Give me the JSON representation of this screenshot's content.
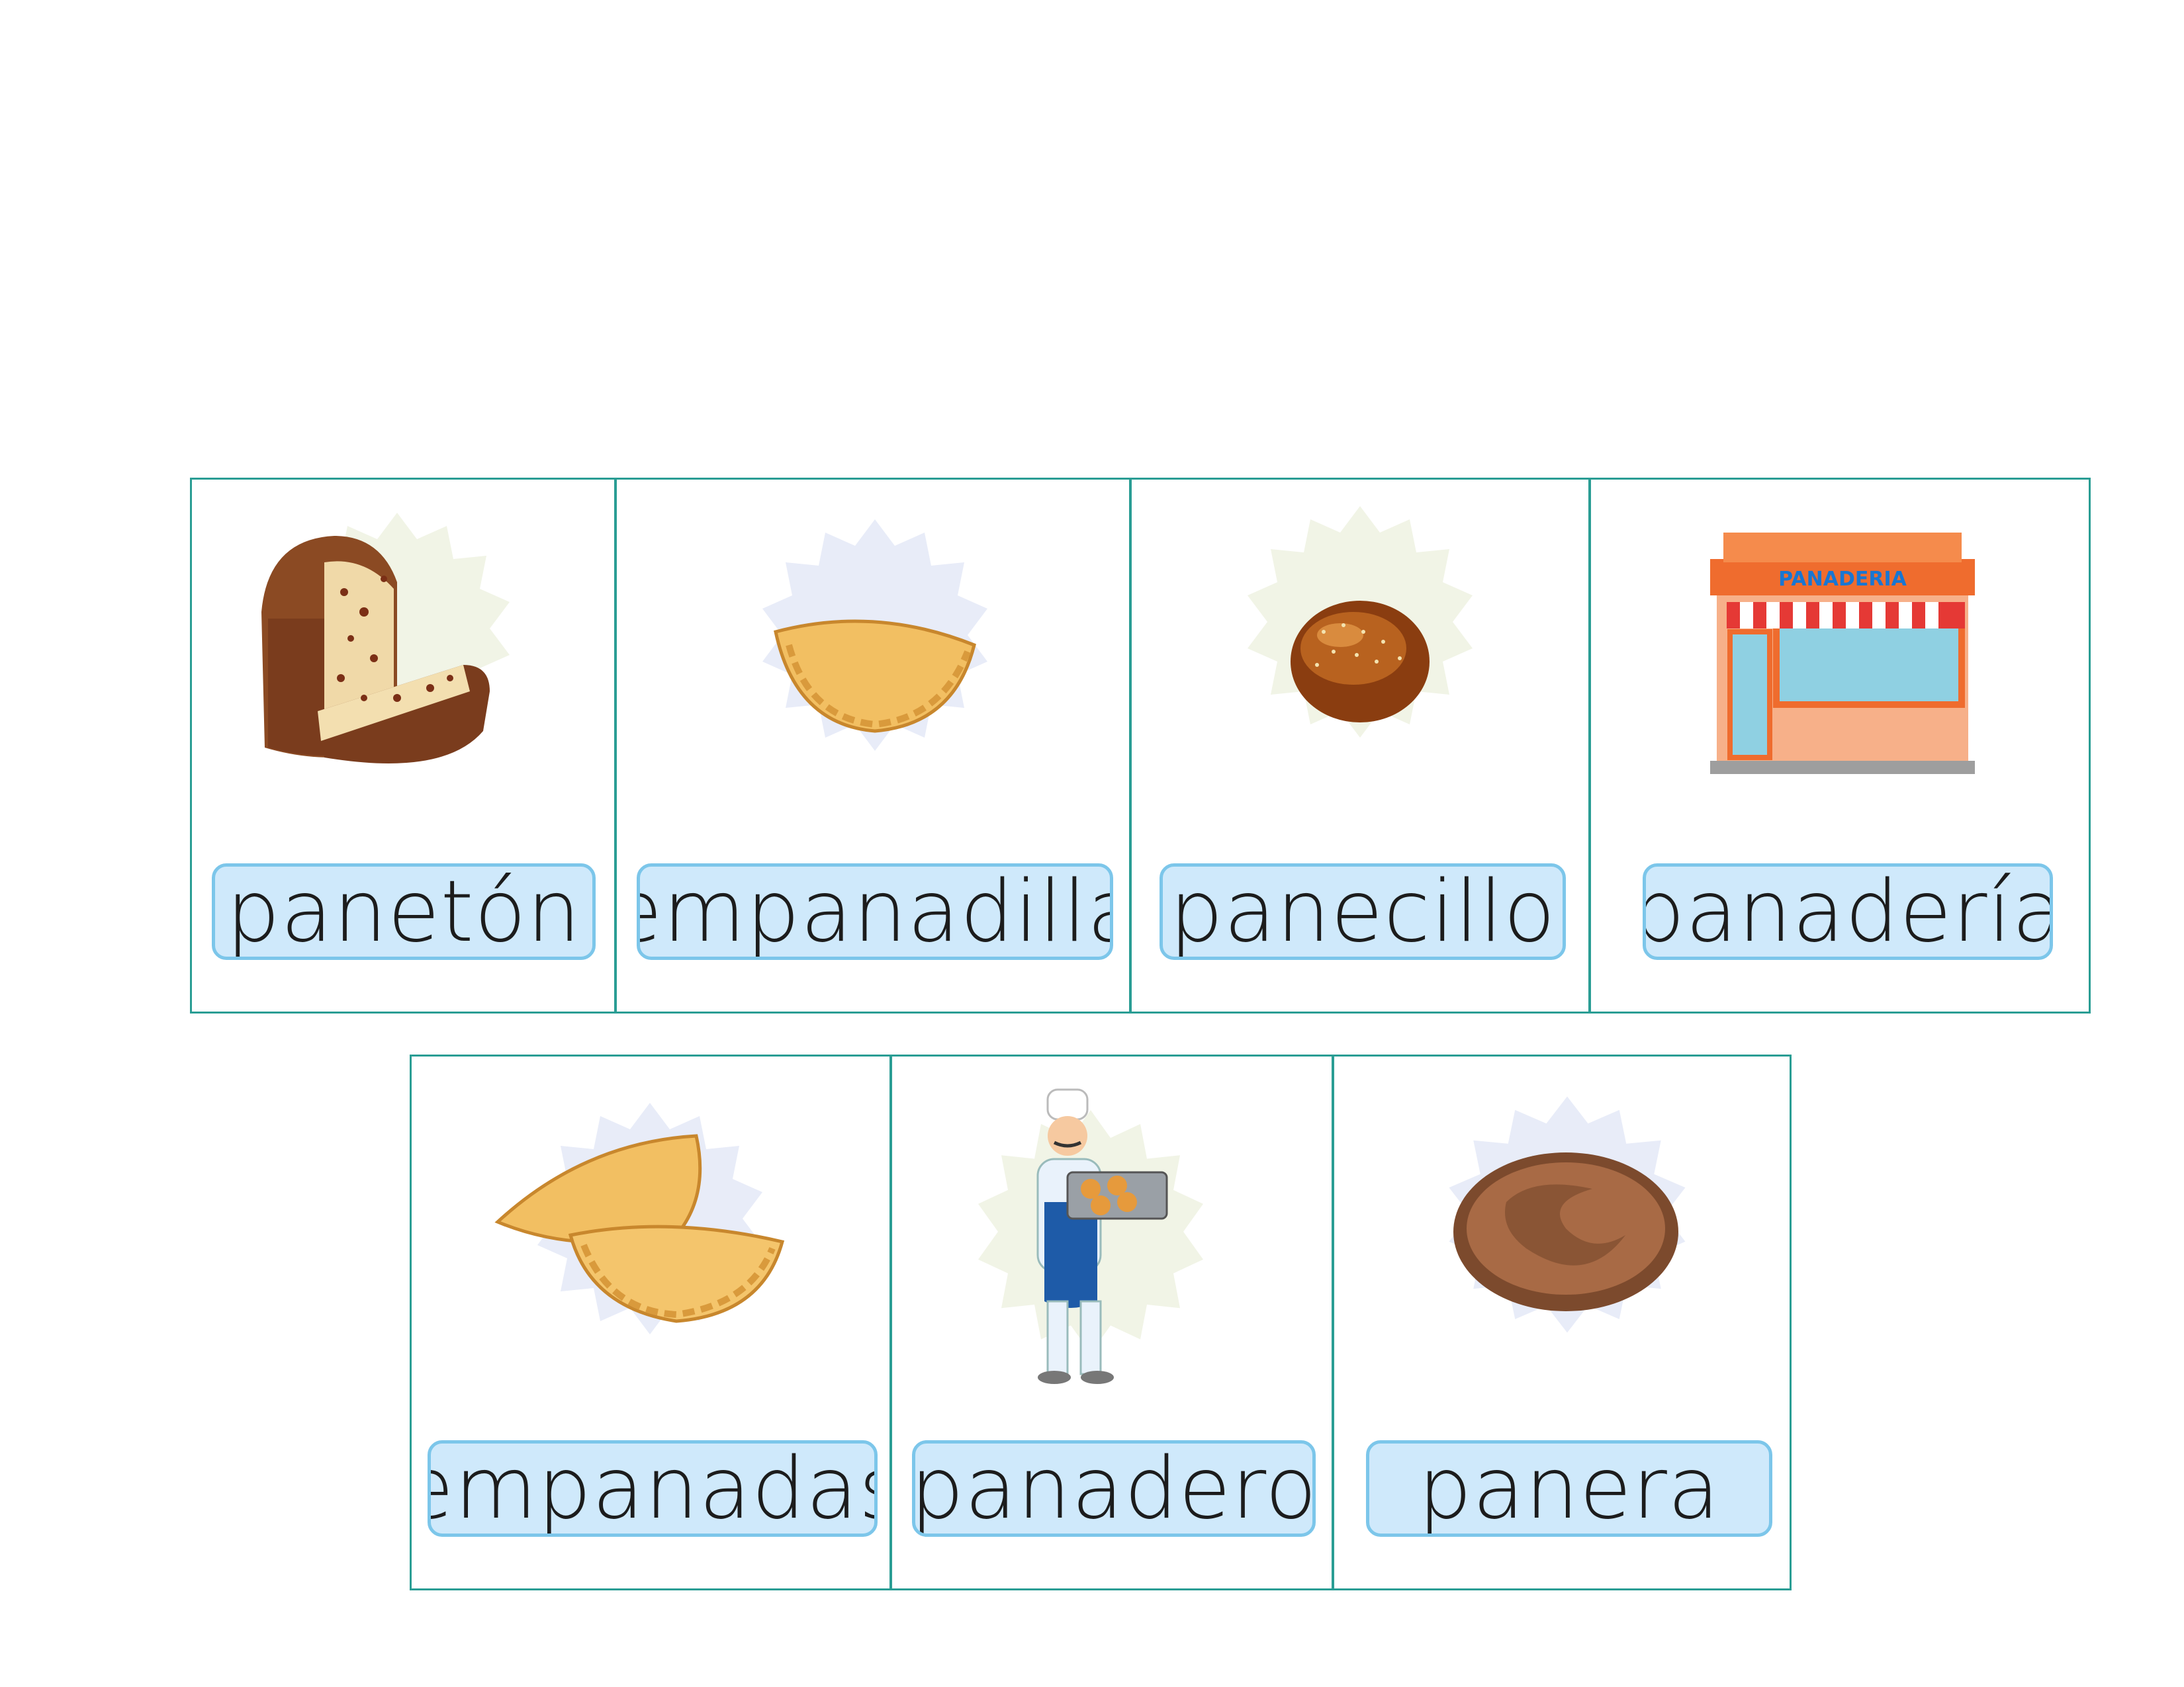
{
  "cards": [
    {
      "word": "panetón",
      "icon": "panettone-icon",
      "badge_color": "#f1f4e6"
    },
    {
      "word": "empanadilla",
      "icon": "empanadilla-icon",
      "badge_color": "#e8ecf8"
    },
    {
      "word": "panecillo",
      "icon": "bread-roll-icon",
      "badge_color": "#f1f4e6"
    },
    {
      "word": "panadería",
      "icon": "bakery-shop-icon",
      "badge_color": "#e8ecf8",
      "shop_sign": "PANADERIA"
    },
    {
      "word": "empanadas",
      "icon": "empanadas-icon",
      "badge_color": "#e8ecf8"
    },
    {
      "word": "panadero",
      "icon": "baker-icon",
      "badge_color": "#f1f4e6"
    },
    {
      "word": "panera",
      "icon": "bread-basket-icon",
      "badge_color": "#e8ecf8"
    }
  ],
  "colors": {
    "border": "#2a9d94",
    "label_fill": "#cfe9fb",
    "label_border": "#7cc6ea"
  }
}
